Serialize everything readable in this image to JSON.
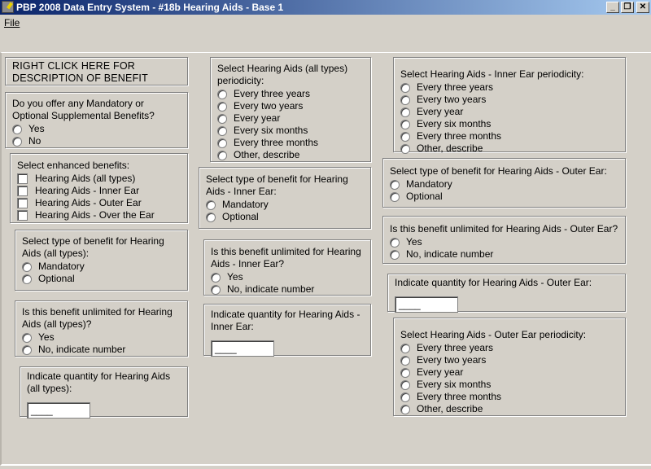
{
  "window": {
    "title": "PBP 2008 Data Entry System - #18b Hearing Aids - Base 1",
    "minimize": "_",
    "restore": "❐",
    "close": "✕"
  },
  "menu": {
    "file": "File"
  },
  "panels": [
    {
      "id": "description",
      "type": "label",
      "title": "RIGHT CLICK HERE FOR DESCRIPTION OF BENEFIT"
    },
    {
      "id": "offer-benefits",
      "type": "radio",
      "title": "Do you offer any Mandatory or Optional Supplemental Benefits?",
      "options": [
        "Yes",
        "No"
      ]
    },
    {
      "id": "enhanced-benefits",
      "type": "check",
      "title": "Select enhanced benefits:",
      "options": [
        "Hearing Aids (all types)",
        "Hearing Aids - Inner Ear",
        "Hearing Aids - Outer Ear",
        "Hearing Aids - Over the Ear"
      ]
    },
    {
      "id": "type-all",
      "type": "radio",
      "title": "Select type of benefit for Hearing Aids (all types):",
      "options": [
        "Mandatory",
        "Optional"
      ]
    },
    {
      "id": "unlimited-all",
      "type": "radio",
      "title": "Is this benefit unlimited for Hearing Aids (all types)?",
      "options": [
        "Yes",
        "No, indicate number"
      ]
    },
    {
      "id": "quantity-all",
      "type": "input",
      "title": "Indicate quantity for Hearing Aids (all types):",
      "value": "____"
    },
    {
      "id": "periodicity-all",
      "type": "radio",
      "title": "Select Hearing Aids (all types) periodicity:",
      "options": [
        "Every three years",
        "Every two years",
        "Every year",
        "Every six months",
        "Every three months",
        "Other, describe"
      ]
    },
    {
      "id": "type-inner",
      "type": "radio",
      "title": "Select type of benefit for Hearing Aids - Inner Ear:",
      "options": [
        "Mandatory",
        "Optional"
      ]
    },
    {
      "id": "unlimited-inner",
      "type": "radio",
      "title": "Is this benefit unlimited for Hearing Aids - Inner Ear?",
      "options": [
        "Yes",
        "No, indicate number"
      ]
    },
    {
      "id": "quantity-inner",
      "type": "input",
      "title": "Indicate quantity for Hearing Aids - Inner Ear:",
      "value": "____"
    },
    {
      "id": "periodicity-inner",
      "type": "radio",
      "title": "Select Hearing Aids - Inner Ear periodicity:",
      "options": [
        "Every three years",
        "Every two years",
        "Every year",
        "Every six months",
        "Every three months",
        "Other, describe"
      ]
    },
    {
      "id": "type-outer",
      "type": "radio",
      "title": "Select type of benefit for Hearing Aids - Outer Ear:",
      "options": [
        "Mandatory",
        "Optional"
      ]
    },
    {
      "id": "unlimited-outer",
      "type": "radio",
      "title": "Is this benefit unlimited for Hearing Aids - Outer Ear?",
      "options": [
        "Yes",
        "No, indicate number"
      ]
    },
    {
      "id": "quantity-outer",
      "type": "input",
      "title": "Indicate quantity for Hearing Aids - Outer Ear:",
      "value": "____"
    },
    {
      "id": "periodicity-outer",
      "type": "radio",
      "title": "Select Hearing Aids - Outer Ear periodicity:",
      "options": [
        "Every three years",
        "Every two years",
        "Every year",
        "Every six months",
        "Every three months",
        "Other, describe"
      ]
    }
  ]
}
